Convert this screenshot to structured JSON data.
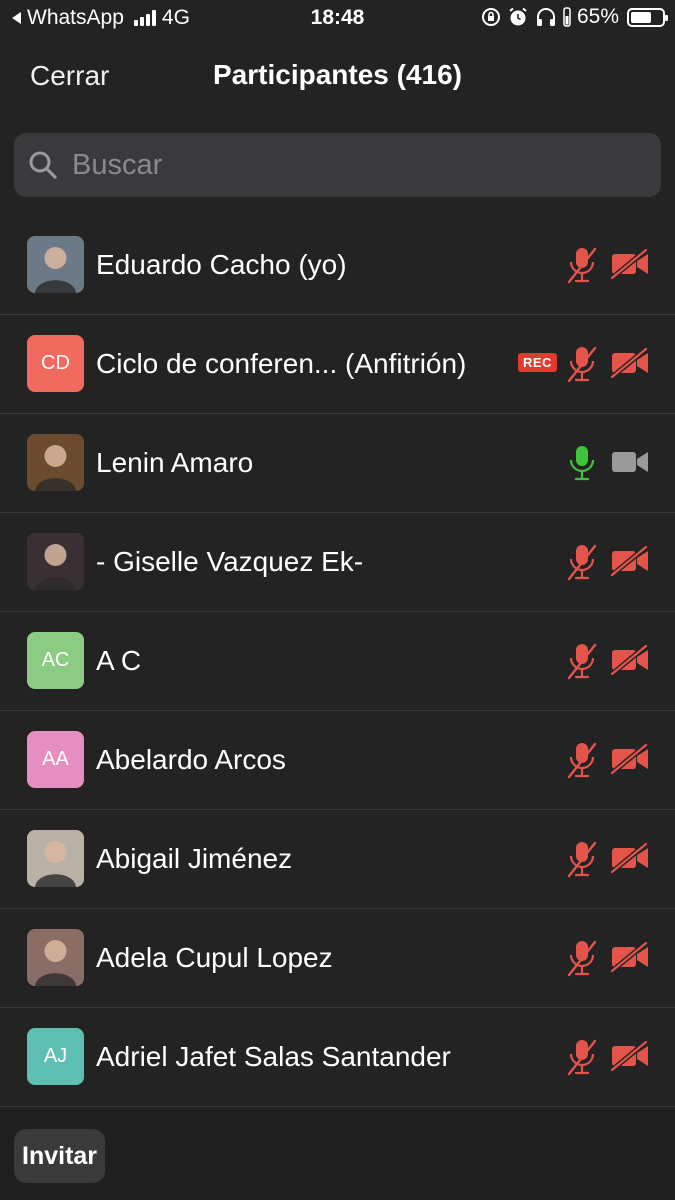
{
  "status_bar": {
    "back_app": "WhatsApp",
    "network": "4G",
    "time": "18:48",
    "battery_percent": "65%",
    "battery_level": 0.65
  },
  "nav": {
    "close_label": "Cerrar",
    "title": "Participantes (416)"
  },
  "search": {
    "placeholder": "Buscar"
  },
  "participants": [
    {
      "name": "Eduardo Cacho (yo)",
      "initials": "",
      "avatar": "photo",
      "avatar_color": "#6b7a86",
      "mic": "muted",
      "video": "off",
      "rec": false
    },
    {
      "name": "Ciclo de conferen... (Anfitrión)",
      "initials": "CD",
      "avatar": "initials",
      "avatar_color": "#f06b5d",
      "mic": "muted",
      "video": "off",
      "rec": true,
      "rec_label": "REC"
    },
    {
      "name": "Lenin Amaro",
      "initials": "",
      "avatar": "photo",
      "avatar_color": "#6b4a2e",
      "mic": "active",
      "video": "idle",
      "rec": false
    },
    {
      "name": "- Giselle Vazquez Ek-",
      "initials": "",
      "avatar": "photo",
      "avatar_color": "#3a2f33",
      "mic": "muted",
      "video": "off",
      "rec": false
    },
    {
      "name": "A C",
      "initials": "AC",
      "avatar": "initials",
      "avatar_color": "#8ccb84",
      "mic": "muted",
      "video": "off",
      "rec": false
    },
    {
      "name": "Abelardo Arcos",
      "initials": "AA",
      "avatar": "initials",
      "avatar_color": "#e48fbf",
      "mic": "muted",
      "video": "off",
      "rec": false
    },
    {
      "name": "Abigail Jiménez",
      "initials": "",
      "avatar": "photo",
      "avatar_color": "#b9b1a6",
      "mic": "muted",
      "video": "off",
      "rec": false
    },
    {
      "name": "Adela Cupul Lopez",
      "initials": "",
      "avatar": "photo",
      "avatar_color": "#8a6e66",
      "mic": "muted",
      "video": "off",
      "rec": false
    },
    {
      "name": "Adriel Jafet Salas Santander",
      "initials": "AJ",
      "avatar": "initials",
      "avatar_color": "#5fbfb3",
      "mic": "muted",
      "video": "off",
      "rec": false
    }
  ],
  "icons": {
    "muted_color": "#e5544b",
    "active_mic_color": "#3ec43a",
    "idle_color": "#9a9a9a"
  },
  "bottom": {
    "invite_label": "Invitar"
  }
}
